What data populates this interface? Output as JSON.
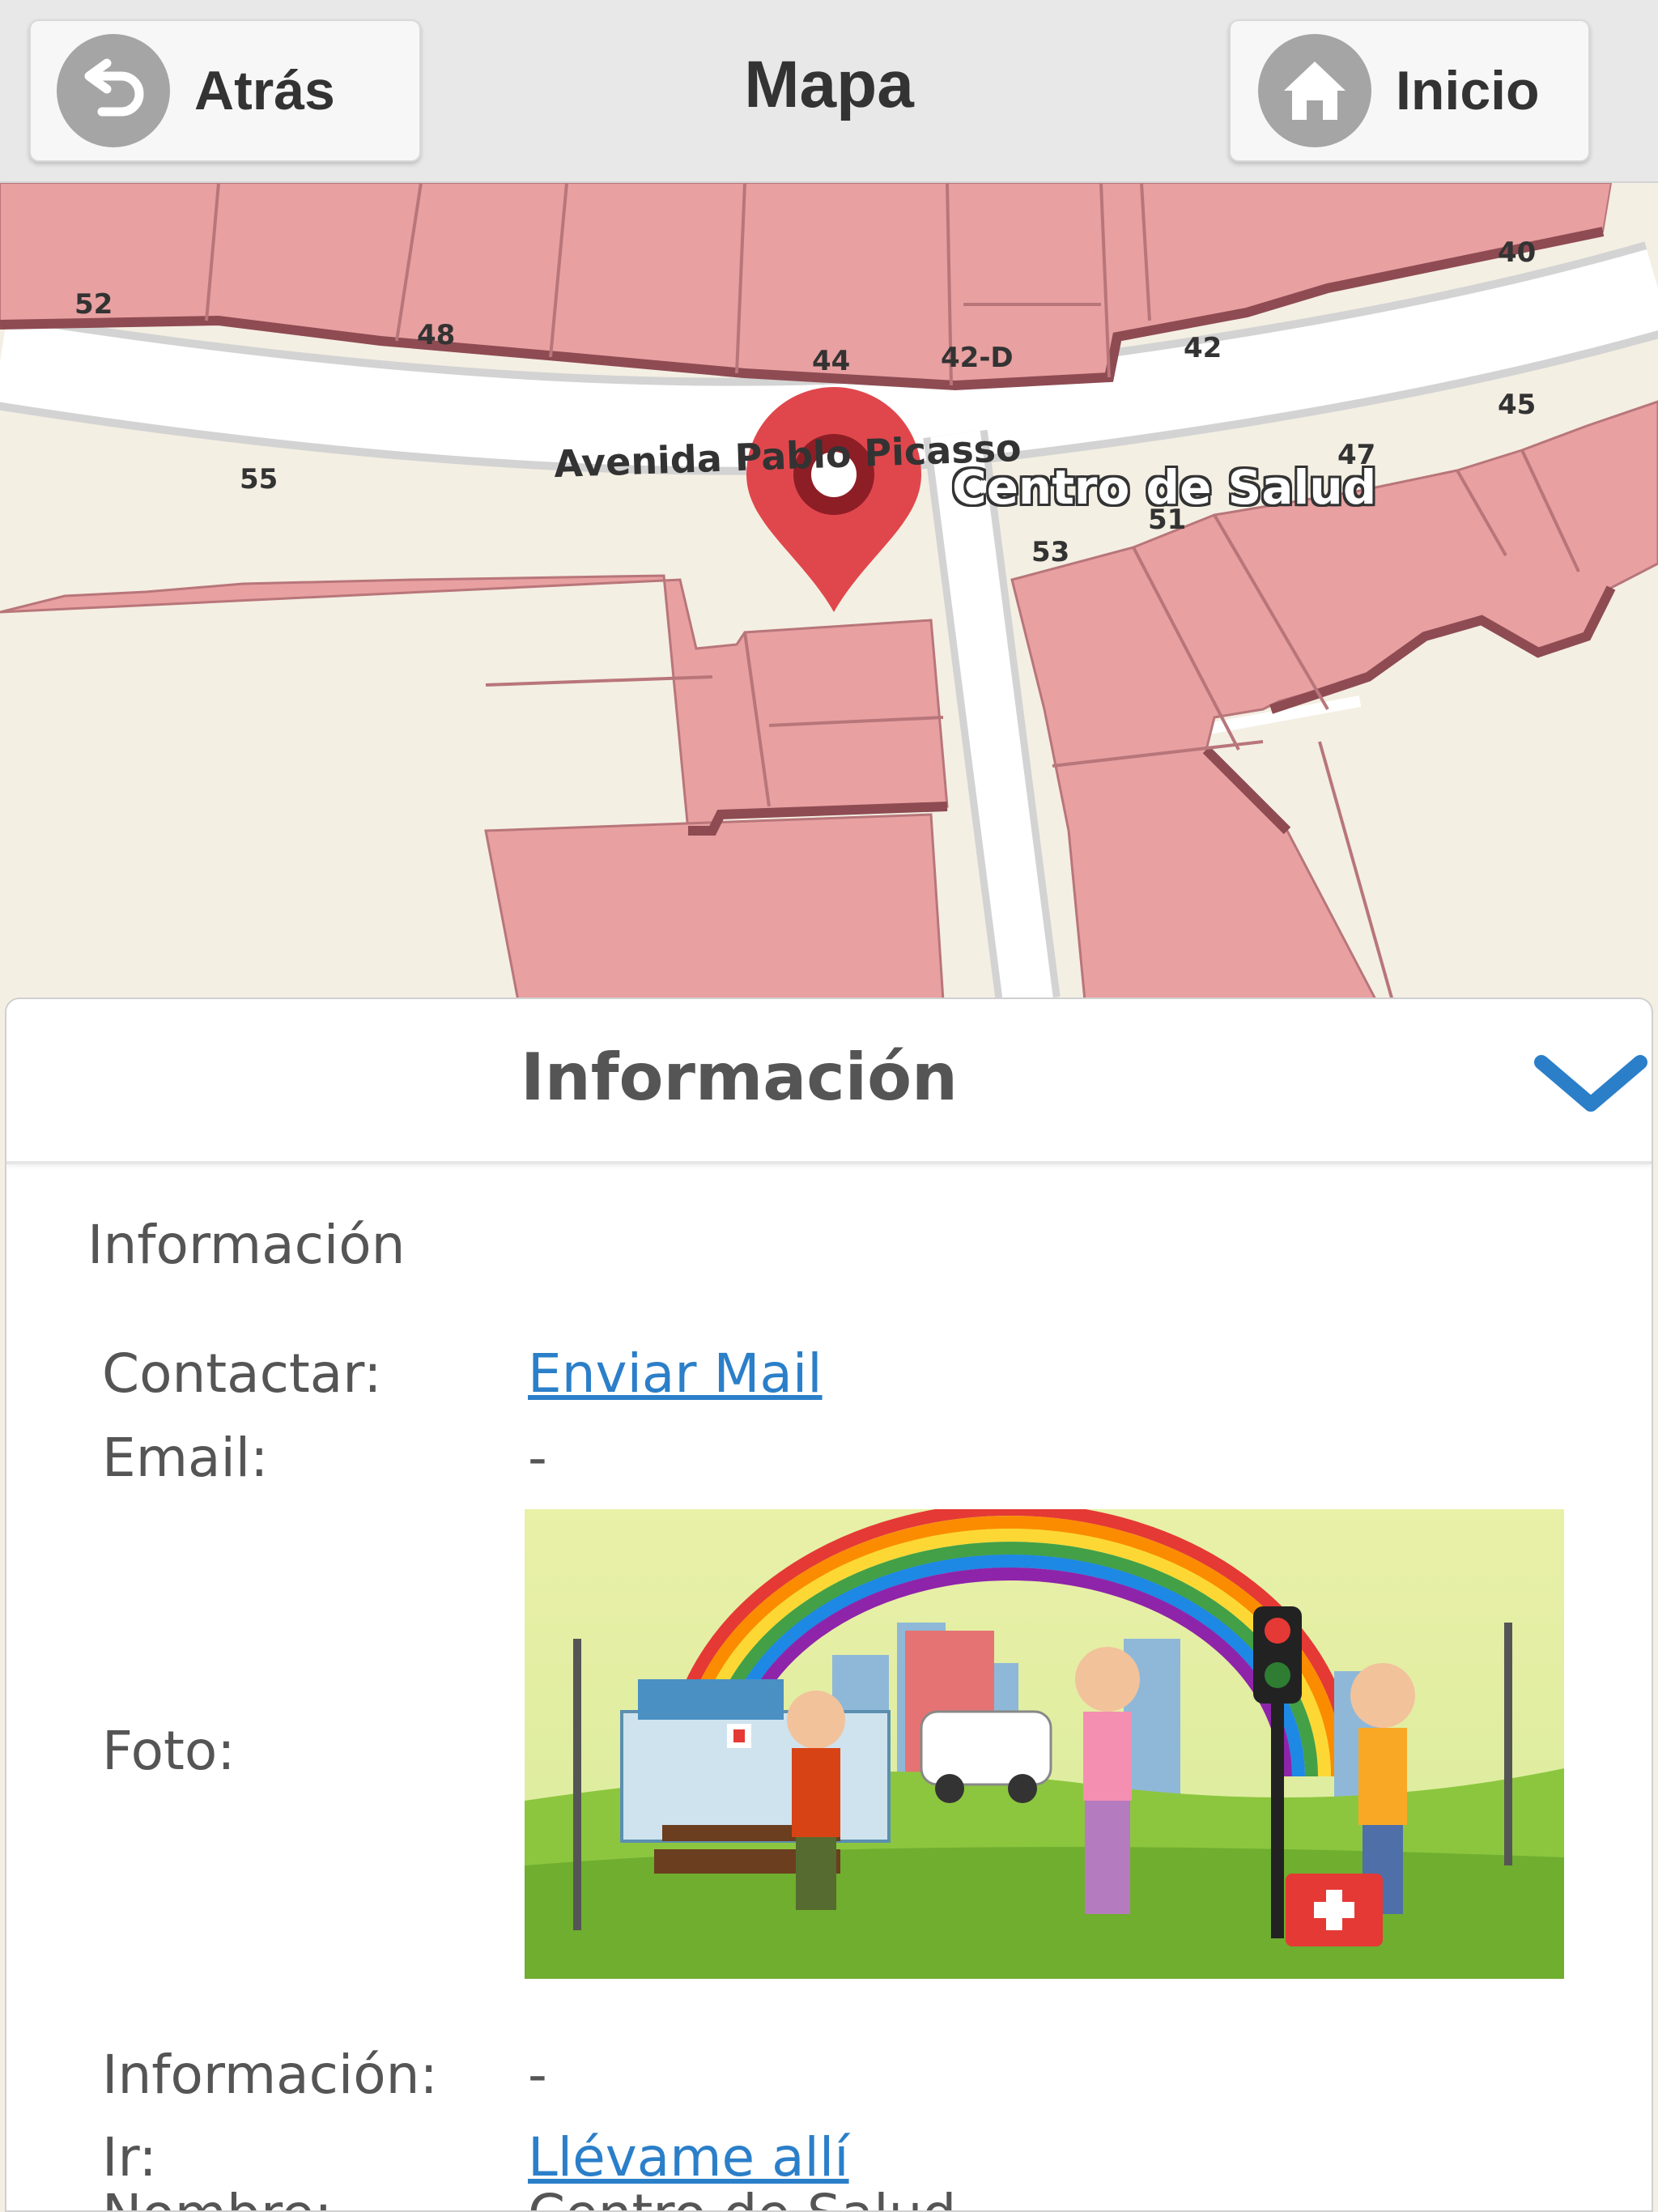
{
  "header": {
    "back_label": "Atrás",
    "title": "Mapa",
    "home_label": "Inicio"
  },
  "map": {
    "street_name": "Avenida Pablo Picasso",
    "poi_name": "Centro de Salud",
    "building_numbers": [
      "52",
      "48",
      "44",
      "42-D",
      "42",
      "40",
      "55",
      "45",
      "47",
      "51",
      "53"
    ],
    "marker_color": "#e0474c",
    "building_color": "#e8a0a1"
  },
  "panel": {
    "title": "Información",
    "section_title": "Información",
    "rows": {
      "contact_label": "Contactar:",
      "contact_link": "Enviar Mail",
      "email_label": "Email:",
      "email_value": "-",
      "photo_label": "Foto:",
      "info_label": "Información:",
      "info_value": "-",
      "go_label": "Ir:",
      "go_link": "Llévame allí",
      "name_label": "Nombre:",
      "name_value": "Centro de Salud"
    },
    "accent_color": "#2b7fc9"
  }
}
